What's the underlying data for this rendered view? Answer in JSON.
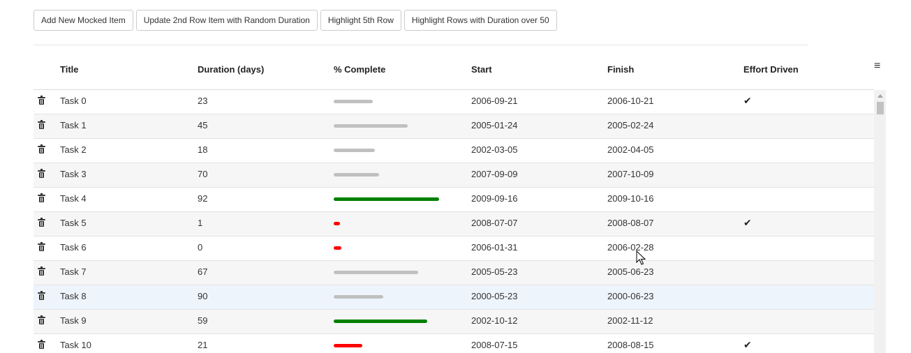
{
  "toolbar": {
    "buttons": [
      {
        "label": "Add New Mocked Item"
      },
      {
        "label": "Update 2nd Row Item with Random Duration"
      },
      {
        "label": "Highlight 5th Row"
      },
      {
        "label": "Highlight Rows with Duration over 50"
      }
    ]
  },
  "grid": {
    "columns": {
      "title": "Title",
      "duration": "Duration (days)",
      "percent": "% Complete",
      "start": "Start",
      "finish": "Finish",
      "effort": "Effort Driven"
    },
    "menu_icon": "hamburger-menu-icon",
    "delete_icon": "trash-icon",
    "effort_icon": "checkmark-icon",
    "bar_colors": {
      "low": "#ff0000",
      "mid": "#c0c0c0",
      "high": "#008000"
    },
    "rows": [
      {
        "title": "Task 0",
        "duration": "23",
        "percent": 37,
        "start": "2006-09-21",
        "finish": "2006-10-21",
        "effort": true
      },
      {
        "title": "Task 1",
        "duration": "45",
        "percent": 70,
        "start": "2005-01-24",
        "finish": "2005-02-24",
        "effort": false
      },
      {
        "title": "Task 2",
        "duration": "18",
        "percent": 39,
        "start": "2002-03-05",
        "finish": "2002-04-05",
        "effort": false
      },
      {
        "title": "Task 3",
        "duration": "70",
        "percent": 43,
        "start": "2007-09-09",
        "finish": "2007-10-09",
        "effort": false
      },
      {
        "title": "Task 4",
        "duration": "92",
        "percent": 100,
        "start": "2009-09-16",
        "finish": "2009-10-16",
        "effort": false
      },
      {
        "title": "Task 5",
        "duration": "1",
        "percent": 6,
        "start": "2008-07-07",
        "finish": "2008-08-07",
        "effort": true
      },
      {
        "title": "Task 6",
        "duration": "0",
        "percent": 7,
        "start": "2006-01-31",
        "finish": "2006-02-28",
        "effort": false
      },
      {
        "title": "Task 7",
        "duration": "67",
        "percent": 80,
        "start": "2005-05-23",
        "finish": "2005-06-23",
        "effort": false
      },
      {
        "title": "Task 8",
        "duration": "90",
        "percent": 47,
        "start": "2000-05-23",
        "finish": "2000-06-23",
        "effort": false
      },
      {
        "title": "Task 9",
        "duration": "59",
        "percent": 89,
        "start": "2002-10-12",
        "finish": "2002-11-12",
        "effort": false
      },
      {
        "title": "Task 10",
        "duration": "21",
        "percent": 27,
        "start": "2008-07-15",
        "finish": "2008-08-15",
        "effort": true
      }
    ],
    "hovered_row": 8
  }
}
